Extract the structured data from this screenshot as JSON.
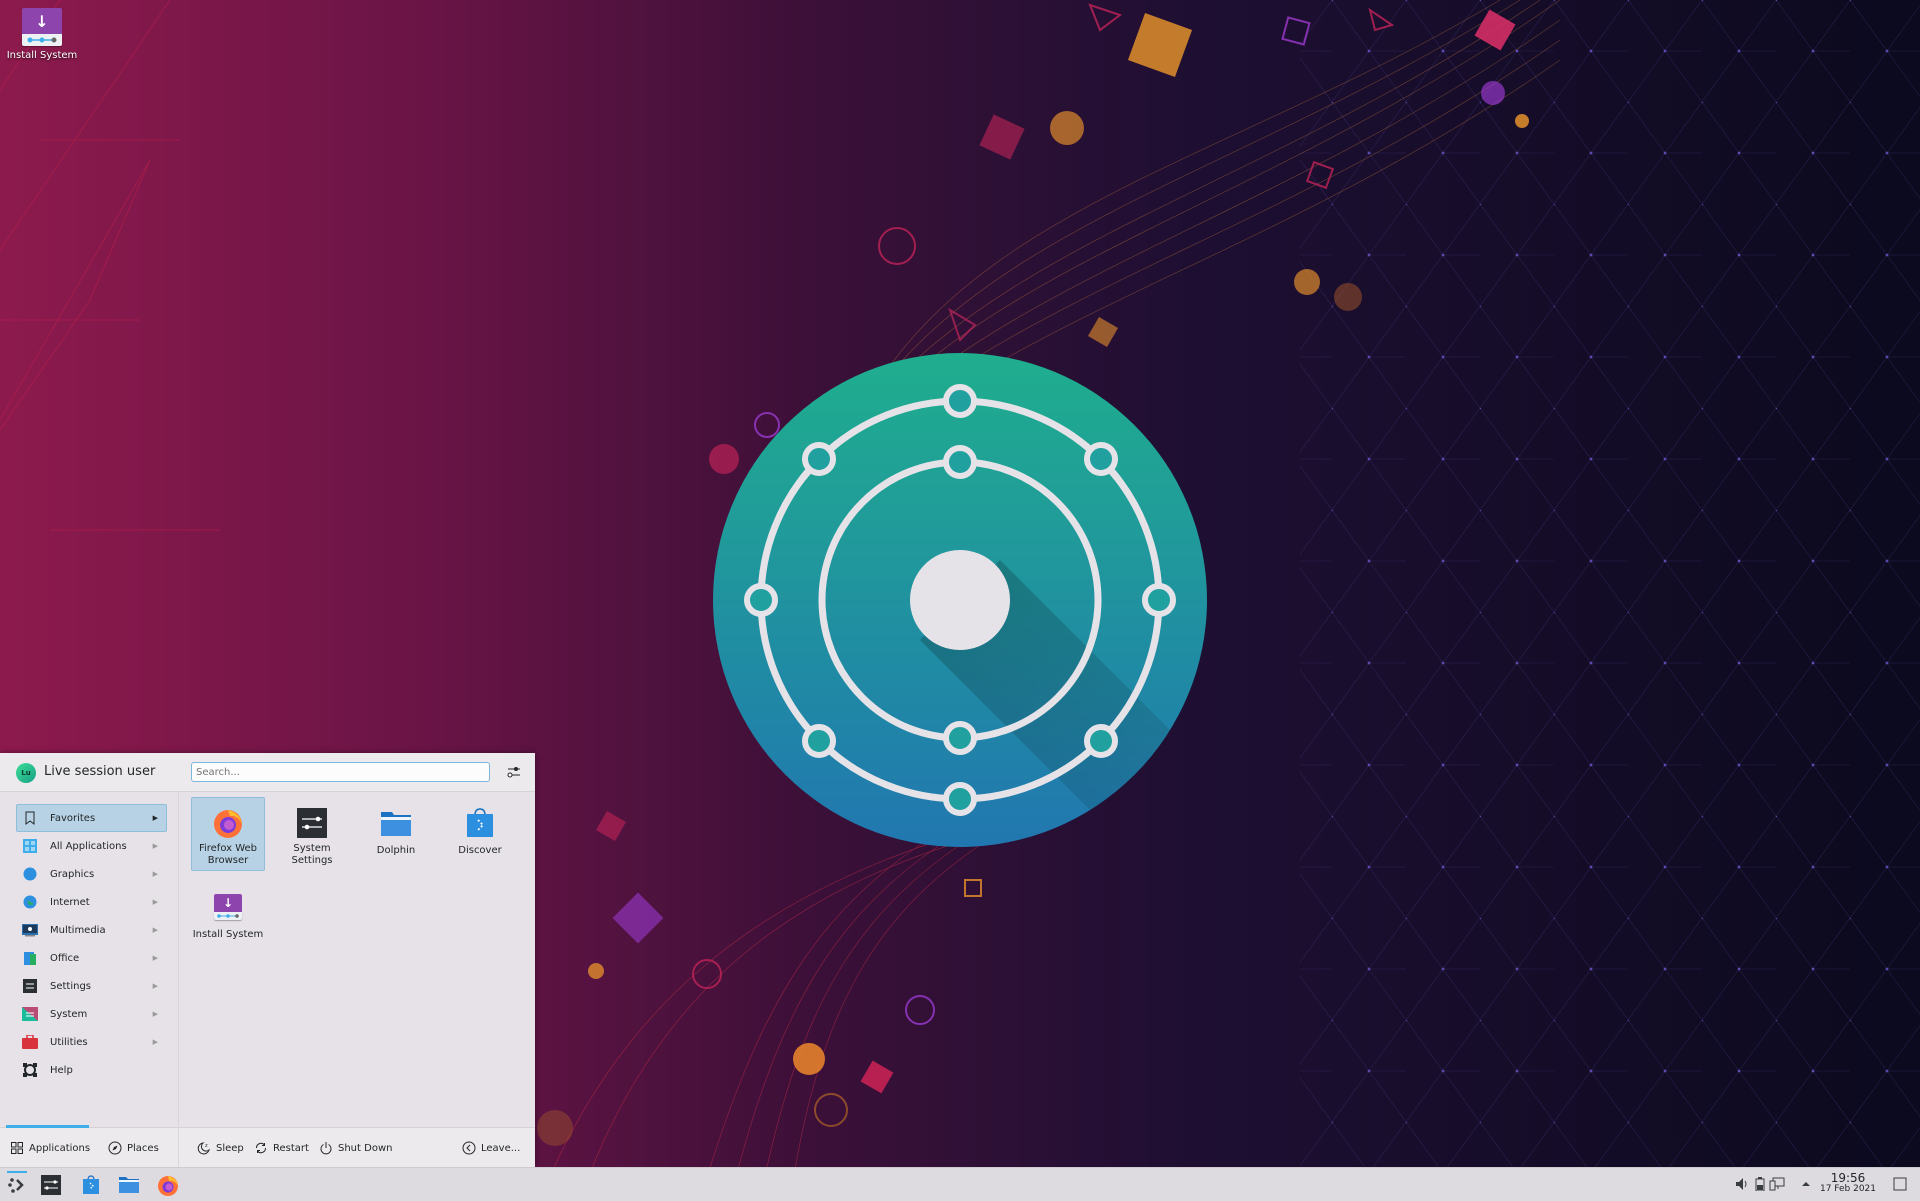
{
  "desktop": {
    "icons": [
      {
        "label": "Install System",
        "icon": "install-system-icon"
      }
    ],
    "wallpaper": {
      "colors": {
        "left": "#8a1848",
        "mid": "#3a1036",
        "right": "#0c0a22",
        "logo_top": "#1fa98f",
        "logo_bottom": "#2279ad",
        "ring": "#e6e3e8"
      }
    }
  },
  "launcher": {
    "user": {
      "initials": "Lu",
      "name": "Live session user"
    },
    "search": {
      "placeholder": "Search...",
      "value": ""
    },
    "config_icon": "configure-icon",
    "categories": [
      {
        "label": "Favorites",
        "icon": "bookmark-icon",
        "active": true
      },
      {
        "label": "All Applications",
        "icon": "all-applications-icon",
        "active": false
      },
      {
        "label": "Graphics",
        "icon": "graphics-icon",
        "active": false
      },
      {
        "label": "Internet",
        "icon": "internet-icon",
        "active": false
      },
      {
        "label": "Multimedia",
        "icon": "multimedia-icon",
        "active": false
      },
      {
        "label": "Office",
        "icon": "office-icon",
        "active": false
      },
      {
        "label": "Settings",
        "icon": "settings-icon",
        "active": false
      },
      {
        "label": "System",
        "icon": "system-icon",
        "active": false
      },
      {
        "label": "Utilities",
        "icon": "utilities-icon",
        "active": false
      },
      {
        "label": "Help",
        "icon": "help-icon",
        "active": false
      }
    ],
    "favorites": [
      {
        "label": "Firefox Web Browser",
        "icon": "firefox-icon",
        "active": true
      },
      {
        "label": "System Settings",
        "icon": "system-settings-icon",
        "active": false
      },
      {
        "label": "Dolphin",
        "icon": "dolphin-folder-icon",
        "active": false
      },
      {
        "label": "Discover",
        "icon": "discover-icon",
        "active": false
      },
      {
        "label": "Install System",
        "icon": "install-system-icon",
        "active": false
      }
    ],
    "footer": {
      "tabs": [
        {
          "label": "Applications",
          "icon": "applications-grid-icon",
          "active": true
        },
        {
          "label": "Places",
          "icon": "compass-icon",
          "active": false
        }
      ],
      "actions": [
        {
          "label": "Sleep",
          "icon": "sleep-icon"
        },
        {
          "label": "Restart",
          "icon": "restart-icon"
        },
        {
          "label": "Shut Down",
          "icon": "shutdown-icon"
        }
      ],
      "leave": {
        "label": "Leave...",
        "icon": "leave-icon"
      }
    },
    "accent": "#3daee9"
  },
  "taskbar": {
    "launcher_icon": "application-launcher-icon",
    "tasks": [
      {
        "name": "System Settings",
        "icon": "system-settings-icon"
      },
      {
        "name": "Discover",
        "icon": "discover-icon"
      },
      {
        "name": "Dolphin",
        "icon": "dolphin-folder-icon"
      },
      {
        "name": "Firefox",
        "icon": "firefox-icon"
      }
    ],
    "tray": [
      {
        "name": "volume",
        "icon": "volume-icon"
      },
      {
        "name": "battery",
        "icon": "battery-icon"
      },
      {
        "name": "network",
        "icon": "network-icon"
      },
      {
        "name": "expand",
        "icon": "chevron-up-icon"
      }
    ],
    "clock": {
      "time": "19:56",
      "date": "17 Feb 2021"
    },
    "show_desktop_icon": "show-desktop-icon"
  }
}
